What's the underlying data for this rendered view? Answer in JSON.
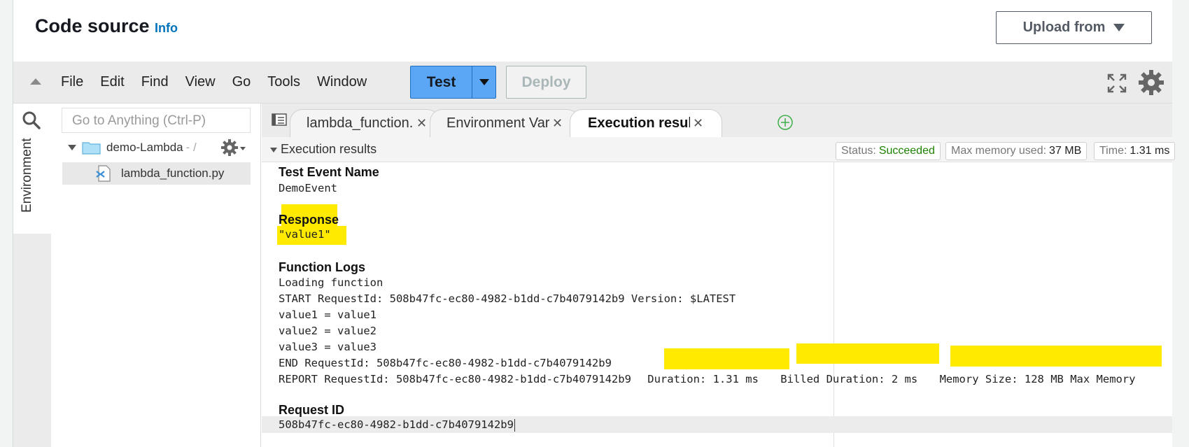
{
  "header": {
    "title": "Code source",
    "info": "Info",
    "upload_label": "Upload from"
  },
  "toolbar": {
    "menu": [
      "File",
      "Edit",
      "Find",
      "View",
      "Go",
      "Tools",
      "Window"
    ],
    "test_label": "Test",
    "deploy_label": "Deploy"
  },
  "sidebar": {
    "goto_placeholder": "Go to Anything (Ctrl-P)",
    "env_tab": "Environment",
    "folder_name": "demo-Lambda",
    "folder_path": "- /",
    "file_name": "lambda_function.py"
  },
  "tabs": [
    {
      "label": "lambda_function."
    },
    {
      "label": "Environment Vari"
    },
    {
      "label": "Execution results"
    }
  ],
  "results": {
    "title": "Execution results",
    "status_label": "Status:",
    "status_value": "Succeeded",
    "memory_label": "Max memory used:",
    "memory_value": "37 MB",
    "time_label": "Time:",
    "time_value": "1.31 ms",
    "test_event_heading": "Test Event Name",
    "test_event_value": "DemoEvent",
    "response_heading": "Response",
    "response_value": "\"value1\"",
    "logs_heading": "Function Logs",
    "logs": [
      "Loading function",
      "START RequestId: 508b47fc-ec80-4982-b1dd-c7b4079142b9 Version: $LATEST",
      "value1 = value1",
      "value2 = value2",
      "value3 = value3",
      "END RequestId: 508b47fc-ec80-4982-b1dd-c7b4079142b9"
    ],
    "report_prefix": "REPORT RequestId: 508b47fc-ec80-4982-b1dd-c7b4079142b9",
    "report_duration": "Duration: 1.31 ms",
    "report_billed": "Billed Duration: 2 ms",
    "report_memory": "Memory Size: 128 MB Max Memory",
    "request_id_heading": "Request ID",
    "request_id_value": "508b47fc-ec80-4982-b1dd-c7b4079142b9"
  },
  "colors": {
    "accent": "#0073bb",
    "test_button": "#5ba7f5",
    "success": "#1d8102",
    "highlight": "#ffea00"
  },
  "icons": [
    "chevron-up-icon",
    "caret-down-icon",
    "fullscreen-icon",
    "gear-icon",
    "search-icon",
    "folder-icon",
    "python-file-icon",
    "tab-list-icon",
    "close-icon",
    "add-tab-icon"
  ]
}
